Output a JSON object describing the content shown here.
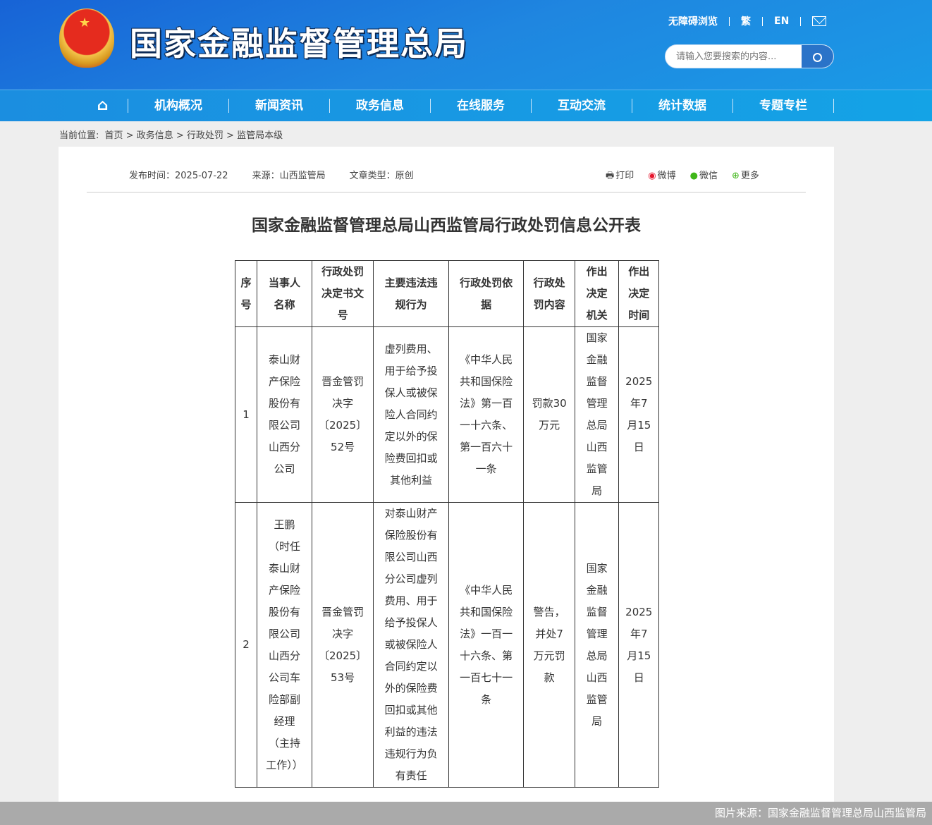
{
  "header": {
    "site_title": "国家金融监督管理总局",
    "accessible": "无障碍浏览",
    "traditional": "繁",
    "english": "EN",
    "search_placeholder": "请输入您要搜索的内容..."
  },
  "nav": [
    "机构概况",
    "新闻资讯",
    "政务信息",
    "在线服务",
    "互动交流",
    "统计数据",
    "专题专栏"
  ],
  "breadcrumb": {
    "label": "当前位置:",
    "items": [
      "首页",
      "政务信息",
      "行政处罚",
      "监管局本级"
    ]
  },
  "meta": {
    "date": "发布时间：2025-07-22",
    "source": "来源：山西监管局",
    "type": "文章类型：原创"
  },
  "share": {
    "print": "打印",
    "weibo": "微博",
    "wechat": "微信",
    "more": "更多"
  },
  "article_title": "国家金融监督管理总局山西监管局行政处罚信息公开表",
  "table": {
    "headers": [
      "序号",
      "当事人名称",
      "行政处罚决定书文号",
      "主要违法违规行为",
      "行政处罚依据",
      "行政处罚内容",
      "作出决定机关",
      "作出决定时间"
    ],
    "rows": [
      [
        "1",
        "泰山财产保险股份有限公司山西分公司",
        "晋金管罚决字〔2025〕52号",
        "虚列费用、用于给予投保人或被保险人合同约定以外的保险费回扣或其他利益",
        "《中华人民共和国保险法》第一百一十六条、第一百六十一条",
        "罚款30万元",
        "国家金融监督管理总局山西监管局",
        "2025年7月15日"
      ],
      [
        "2",
        "王鹏（时任泰山财产保险股份有限公司山西分公司车险部副经理（主持工作））",
        "晋金管罚决字〔2025〕53号",
        "对泰山财产保险股份有限公司山西分公司虚列费用、用于给予投保人或被保险人合同约定以外的保险费回扣或其他利益的违法违规行为负有责任",
        "《中华人民共和国保险法》一百一十六条、第一百七十一条",
        "警告，并处7万元罚款",
        "国家金融监督管理总局山西监管局",
        "2025年7月15日"
      ]
    ]
  },
  "footer": "图片来源：国家金融监督管理总局山西监管局"
}
